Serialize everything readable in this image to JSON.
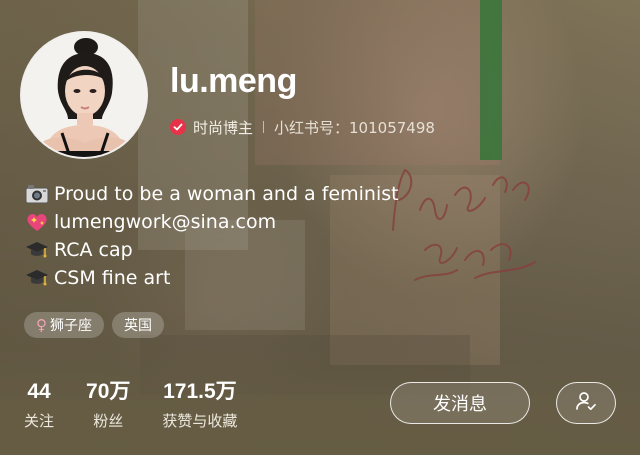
{
  "profile": {
    "username": "lu.meng",
    "role": "时尚博主",
    "redbook_id": "小红书号：101057498",
    "verified": true
  },
  "bio": [
    {
      "icon": "camera-icon",
      "text": "Proud to be a woman and a feminist"
    },
    {
      "icon": "sparkling-heart-icon",
      "text": "lumengwork@sina.com"
    },
    {
      "icon": "graduation-cap-icon",
      "text": "RCA cap"
    },
    {
      "icon": "graduation-cap-icon",
      "text": "CSM fine art"
    }
  ],
  "tags": [
    {
      "symbol": "♀",
      "label": "狮子座"
    },
    {
      "label": "英国"
    }
  ],
  "stats": [
    {
      "value": "44",
      "label": "关注"
    },
    {
      "value": "70万",
      "label": "粉丝"
    },
    {
      "value": "171.5万",
      "label": "获赞与收藏"
    }
  ],
  "actions": {
    "message_label": "发消息",
    "follow_icon": "user-check-icon"
  },
  "colors": {
    "verify_badge": "#e8324a",
    "background": "#6c6049"
  }
}
